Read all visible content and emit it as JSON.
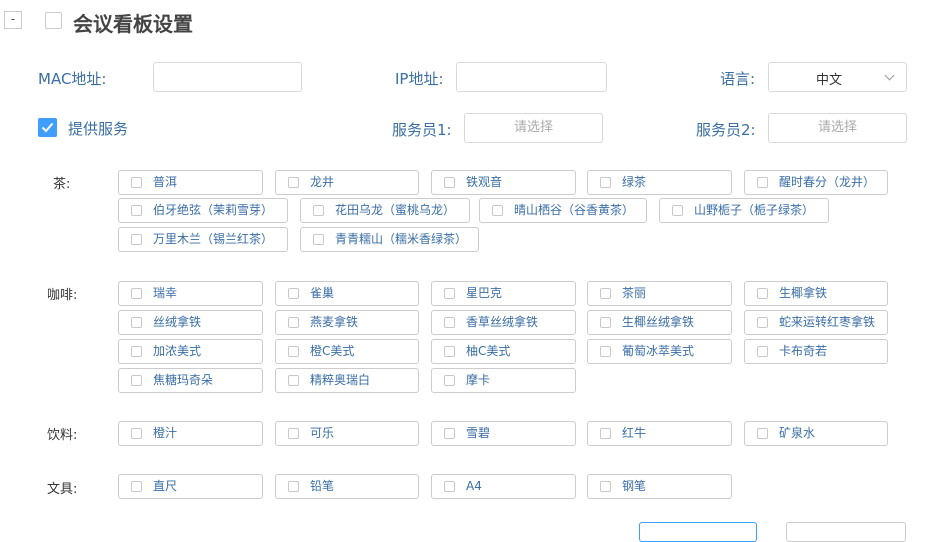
{
  "header": {
    "collapse_label": "-",
    "title": "会议看板设置"
  },
  "form": {
    "mac_label": "MAC地址:",
    "mac_value": "",
    "ip_label": "IP地址:",
    "ip_value": "",
    "lang_label": "语言:",
    "lang_value": "中文",
    "provide_label": "提供服务",
    "provide_checked": true,
    "waiter1_label": "服务员1:",
    "waiter1_placeholder": "请选择",
    "waiter2_label": "服务员2:",
    "waiter2_placeholder": "请选择"
  },
  "categories": [
    {
      "label": "茶:",
      "options": [
        "普洱",
        "龙井",
        "铁观音",
        "绿茶",
        "醒时春分（龙井）",
        "伯牙绝弦（茉莉雪芽）",
        "花田乌龙（蜜桃乌龙）",
        "晴山栖谷（谷香黄茶）",
        "山野栀子（栀子绿茶）",
        "万里木兰（锡兰红茶）",
        "青青糯山（糯米香绿茶）"
      ]
    },
    {
      "label": "咖啡:",
      "options": [
        "瑞幸",
        "雀巢",
        "星巴克",
        "茶丽",
        "生椰拿铁",
        "丝绒拿铁",
        "燕麦拿铁",
        "香草丝绒拿铁",
        "生椰丝绒拿铁",
        "蛇来运转红枣拿铁",
        "加浓美式",
        "橙C美式",
        "柚C美式",
        "葡萄冰萃美式",
        "卡布奇若",
        "焦糖玛奇朵",
        "精粹奥瑞白",
        "摩卡"
      ]
    },
    {
      "label": "饮料:",
      "options": [
        "橙汁",
        "可乐",
        "雪碧",
        "红牛",
        "矿泉水"
      ]
    },
    {
      "label": "文具:",
      "options": [
        "直尺",
        "铅笔",
        "A4",
        "钢笔"
      ]
    }
  ],
  "colors": {
    "accent": "#409eff",
    "label_blue": "#3a6ea5",
    "border": "#cccccc"
  }
}
